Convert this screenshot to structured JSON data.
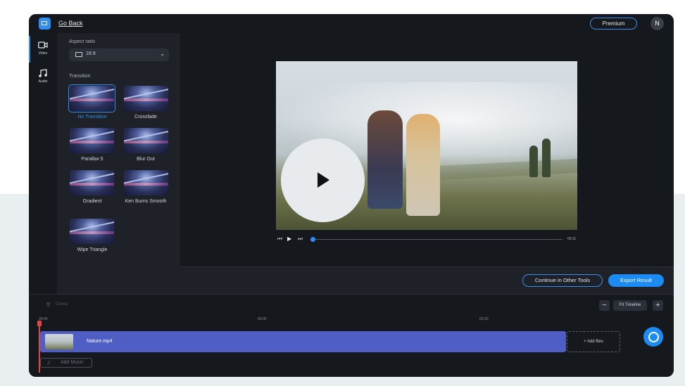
{
  "topbar": {
    "go_back": "Go Back",
    "premium": "Premium",
    "avatar_initial": "N"
  },
  "leftnav": [
    {
      "label": "Video",
      "icon": "video-camera-icon",
      "active": true
    },
    {
      "label": "Audio",
      "icon": "music-note-icon",
      "active": false
    }
  ],
  "panel": {
    "aspect_title": "Aspect ratio",
    "aspect_value": "16:9",
    "transition_title": "Transition",
    "transitions": [
      "No Transition",
      "Crossfade",
      "Parallax 5",
      "Blur Out",
      "Gradient",
      "Ken Burns Smooth",
      "Wipe Triangle"
    ],
    "selected_transition": "No Transition"
  },
  "player": {
    "end_time": "00:11",
    "progress": 0.0
  },
  "actions": {
    "continue": "Continue in Other Tools",
    "export": "Export Result"
  },
  "timeline": {
    "delete": "Delete",
    "fit": "Fit Timeline",
    "zoom_out": "−",
    "zoom_in": "+",
    "ruler": [
      "00:00",
      "00:05",
      "00:10"
    ],
    "clip_name": "Nature.mp4",
    "add_files": "+  Add files",
    "add_music": "Add Music"
  },
  "colors": {
    "accent": "#1c8cf3",
    "clip": "#4f5ec4",
    "playhead": "#e04848"
  }
}
